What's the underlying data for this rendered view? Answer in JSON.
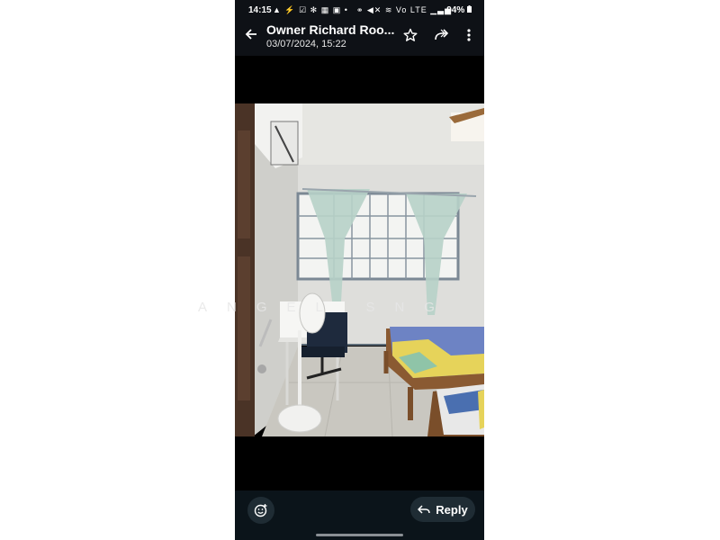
{
  "status_bar": {
    "time": "14:15",
    "left_icons": "▲ ⚡ ☑ ✻ ▦ ▣ •",
    "right_icons": "⚭ ◀✕ ≋ Vo LTE ▁▃▅",
    "battery": "94%"
  },
  "header": {
    "title": "Owner Richard Roo...",
    "date": "03/07/2024, 15:22"
  },
  "photo": {
    "watermark": "ANGEL SNG"
  },
  "bottom_bar": {
    "reply_label": "Reply"
  },
  "colors": {
    "header_bg": "#0e1116",
    "bottom_bg": "#0b141a",
    "button_bg": "#1f2c34"
  }
}
